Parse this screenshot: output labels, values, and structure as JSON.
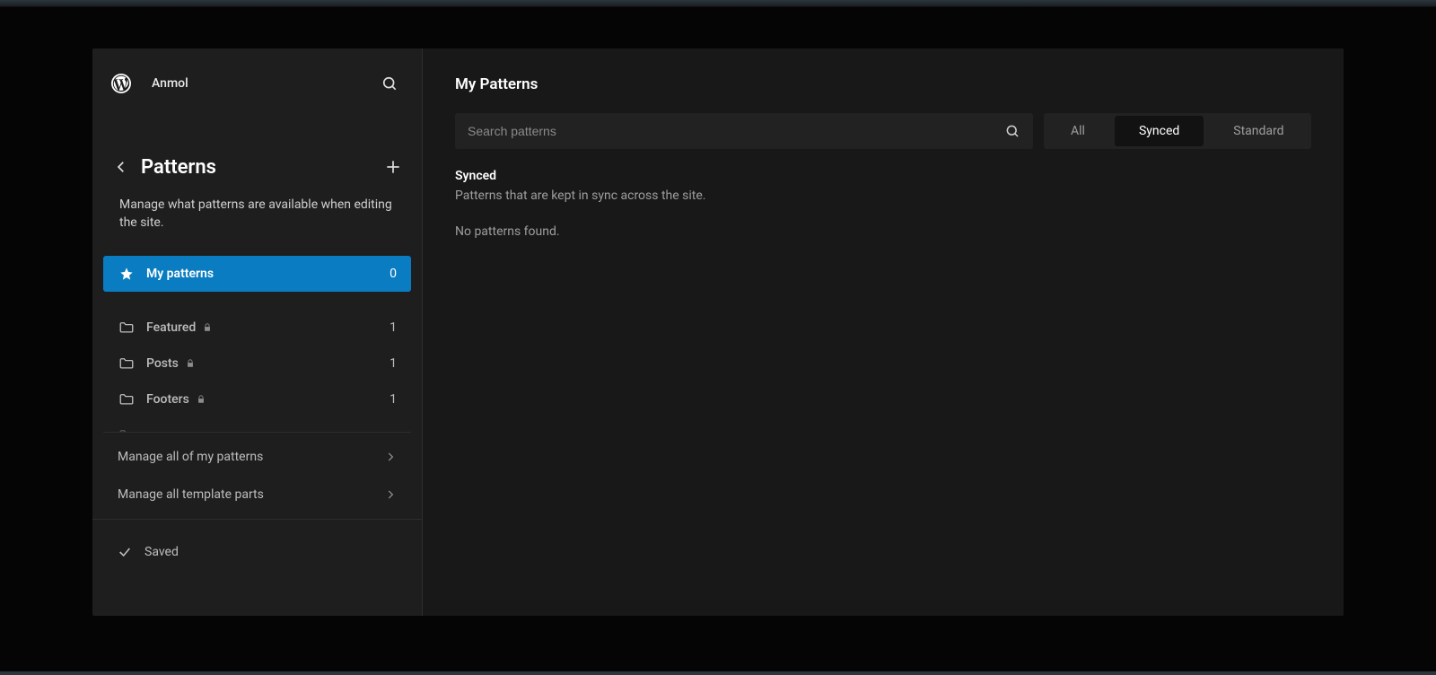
{
  "site_name": "Anmol",
  "sidebar": {
    "title": "Patterns",
    "description": "Manage what patterns are available when editing the site.",
    "active_category": {
      "label": "My patterns",
      "count": 0
    },
    "categories": [
      {
        "label": "Featured",
        "locked": true,
        "count": 1
      },
      {
        "label": "Posts",
        "locked": true,
        "count": 1
      },
      {
        "label": "Footers",
        "locked": true,
        "count": 1
      }
    ],
    "manage_links": [
      {
        "label": "Manage all of my patterns"
      },
      {
        "label": "Manage all template parts"
      }
    ],
    "save_state": "Saved"
  },
  "main": {
    "title": "My Patterns",
    "search_placeholder": "Search patterns",
    "filters": [
      {
        "label": "All",
        "active": false
      },
      {
        "label": "Synced",
        "active": true
      },
      {
        "label": "Standard",
        "active": false
      }
    ],
    "section_title": "Synced",
    "section_desc": "Patterns that are kept in sync across the site.",
    "empty_text": "No patterns found."
  }
}
